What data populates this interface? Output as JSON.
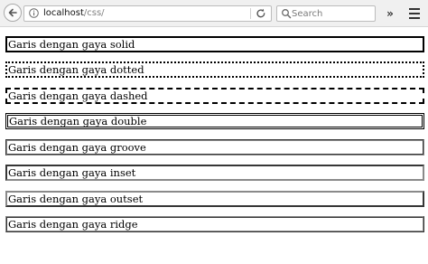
{
  "browser": {
    "url_host": "localhost",
    "url_path": "/css/",
    "search_placeholder": "Search",
    "overflow_label": "»",
    "icons": {
      "back": "arrow-left-icon",
      "info": "info-icon",
      "reload": "reload-icon",
      "search": "magnifier-icon",
      "menu": "hamburger-menu-icon"
    }
  },
  "page": {
    "lines": [
      {
        "style": "solid",
        "label": "Garis dengan gaya solid"
      },
      {
        "style": "dotted",
        "label": "Garis dengan gaya dotted"
      },
      {
        "style": "dashed",
        "label": "Garis dengan gaya dashed"
      },
      {
        "style": "double",
        "label": "Garis dengan gaya double"
      },
      {
        "style": "groove",
        "label": "Garis dengan gaya groove"
      },
      {
        "style": "inset",
        "label": "Garis dengan gaya inset"
      },
      {
        "style": "outset",
        "label": "Garis dengan gaya outset"
      },
      {
        "style": "ridge",
        "label": "Garis dengan gaya ridge"
      }
    ]
  }
}
